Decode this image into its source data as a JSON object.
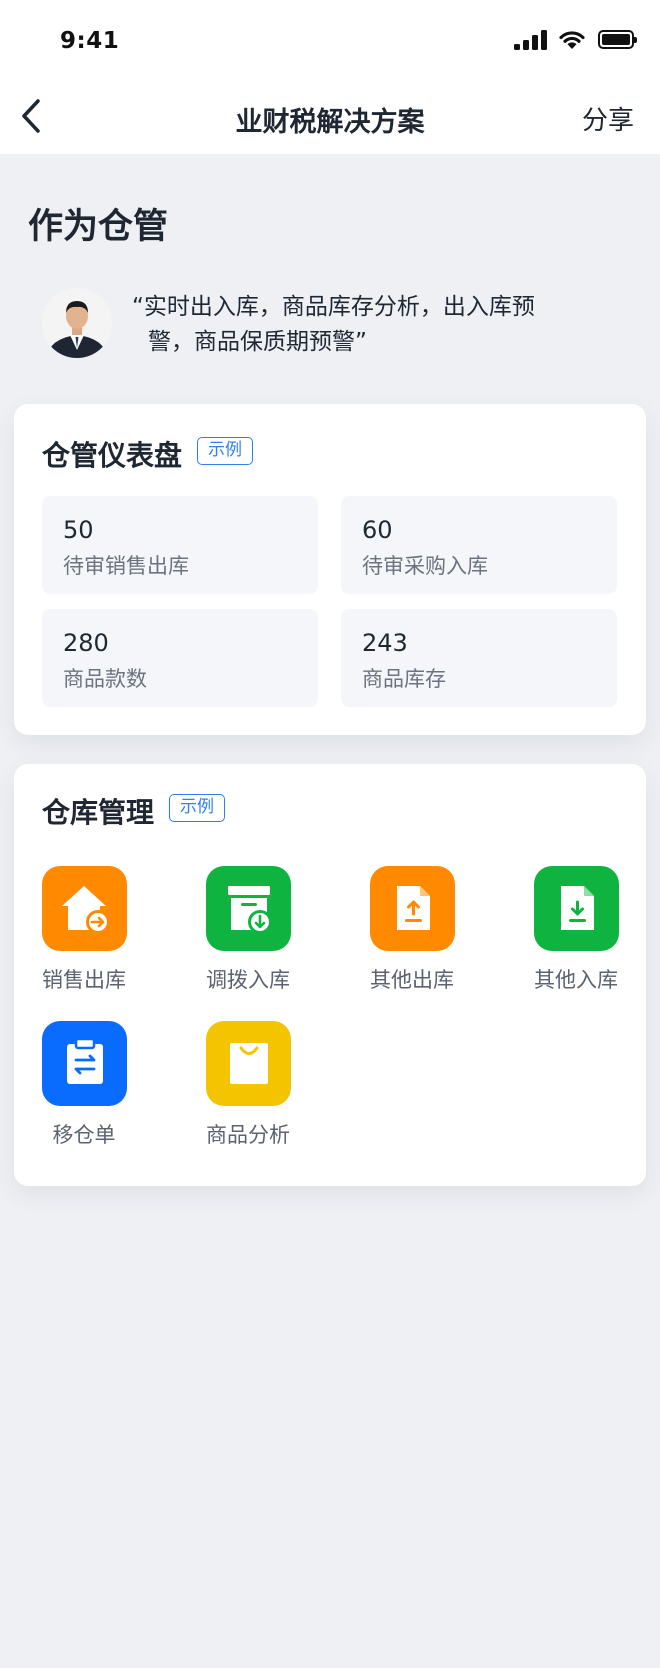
{
  "status_bar": {
    "time": "9:41"
  },
  "nav": {
    "title": "业财税解决方案",
    "share_label": "分享"
  },
  "role": {
    "title": "作为仓管"
  },
  "quote": {
    "line1": "“实时出入库，商品库存分析，出入库预",
    "line2": "警，商品保质期预警”"
  },
  "dashboard": {
    "title": "仓管仪表盘",
    "tag": "示例",
    "stats": [
      {
        "value": "50",
        "label": "待审销售出库"
      },
      {
        "value": "60",
        "label": "待审采购入库"
      },
      {
        "value": "280",
        "label": "商品款数"
      },
      {
        "value": "243",
        "label": "商品库存"
      }
    ]
  },
  "warehouse": {
    "title": "仓库管理",
    "tag": "示例",
    "apps": [
      {
        "label": "销售出库",
        "icon": "house-arrow-icon",
        "color": "#ff8a00"
      },
      {
        "label": "调拨入库",
        "icon": "box-download-icon",
        "color": "#0fb440"
      },
      {
        "label": "其他出库",
        "icon": "doc-upload-icon",
        "color": "#ff8a00"
      },
      {
        "label": "其他入库",
        "icon": "doc-download-icon",
        "color": "#0fb440"
      },
      {
        "label": "移仓单",
        "icon": "clipboard-transfer-icon",
        "color": "#0a6cff"
      },
      {
        "label": "商品分析",
        "icon": "shopping-bag-icon",
        "color": "#f5c400"
      }
    ]
  }
}
